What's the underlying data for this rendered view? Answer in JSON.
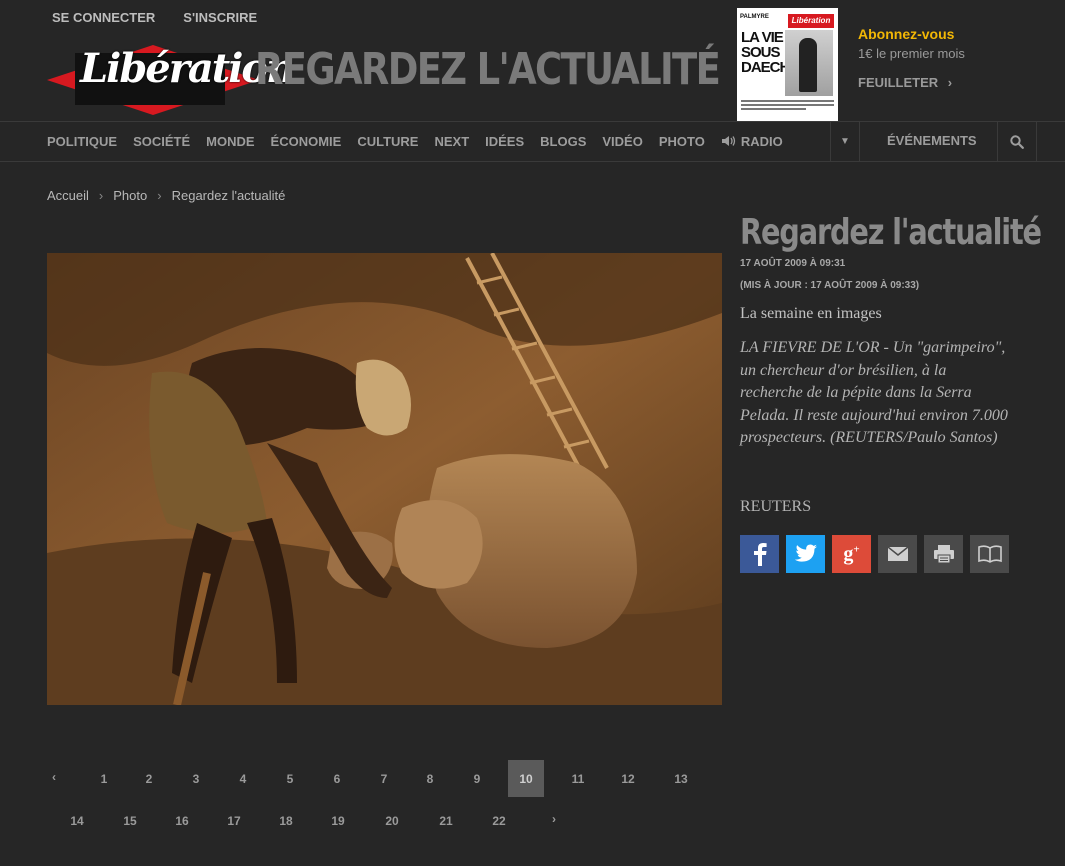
{
  "top": {
    "login": "SE CONNECTER",
    "signup": "S'INSCRIRE",
    "logo_text": "Libération",
    "headline": "REGARDEZ L'ACTUALITÉ"
  },
  "cover": {
    "masthead": "Libération",
    "tag": "PALMYRE",
    "title_lines": [
      "LA VIE",
      "SOUS",
      "DAECH"
    ]
  },
  "subscribe": {
    "title": "Abonnez-vous",
    "offer": "1€ le premier mois",
    "feuilleter": "FEUILLETER"
  },
  "nav": {
    "items": [
      "POLITIQUE",
      "SOCIÉTÉ",
      "MONDE",
      "ÉCONOMIE",
      "CULTURE",
      "NEXT",
      "IDÉES",
      "BLOGS",
      "VIDÉO",
      "PHOTO",
      "RADIO"
    ],
    "events": "ÉVÉNEMENTS"
  },
  "breadcrumb": [
    "Accueil",
    "Photo",
    "Regardez l'actualité"
  ],
  "article": {
    "title": "Regardez l'actualité",
    "date": "17 AOÛT 2009 À 09:31",
    "updated": "(MIS À JOUR : 17 AOÛT 2009 À 09:33)",
    "lead": "La semaine en images",
    "caption": "LA FIEVRE DE L'OR - Un \"garimpeiro\", un chercheur d'or brésilien, à la recherche de la pépite dans la Serra Pelada. Il reste aujourd'hui environ 7.000 prospecteurs. (REUTERS/Paulo Santos)",
    "credit": "REUTERS"
  },
  "pagination": {
    "current": "10",
    "pages": [
      "1",
      "2",
      "3",
      "4",
      "5",
      "6",
      "7",
      "8",
      "9",
      "10",
      "11",
      "12",
      "13",
      "14",
      "15",
      "16",
      "17",
      "18",
      "19",
      "20",
      "21",
      "22"
    ]
  },
  "colors": {
    "background": "#262626",
    "accent_yellow": "#f2b705",
    "logo_red": "#d71920",
    "facebook": "#3b5998",
    "twitter": "#1da1f2",
    "googleplus": "#dd4b39"
  }
}
